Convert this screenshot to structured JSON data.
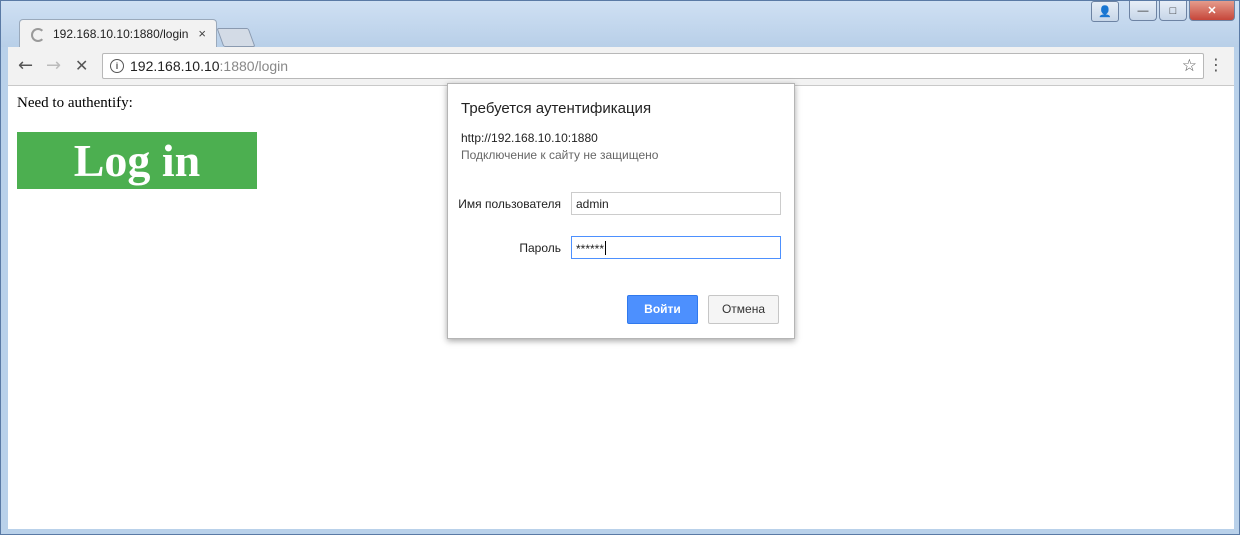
{
  "tab": {
    "title": "192.168.10.10:1880/login",
    "close": "×"
  },
  "window_buttons": {
    "minimize": "—",
    "maximize": "□",
    "close": "✕",
    "user": "👤"
  },
  "toolbar": {
    "back": "←",
    "forward": "→",
    "stop": "✕",
    "url_host": "192.168.10.10",
    "url_path": ":1880/login",
    "info": "i",
    "star": "☆",
    "menu": "⋮"
  },
  "page": {
    "need_text": "Need to authentify:",
    "login_button": "Log in"
  },
  "dialog": {
    "title": "Требуется аутентификация",
    "url": "http://192.168.10.10:1880",
    "warning": "Подключение к сайту не защищено",
    "username_label": "Имя пользователя",
    "username_value": "admin",
    "password_label": "Пароль",
    "password_value": "******",
    "ok_label": "Войти",
    "cancel_label": "Отмена"
  },
  "colors": {
    "login_button_bg": "#4caf50",
    "primary_button": "#4d90fe"
  }
}
